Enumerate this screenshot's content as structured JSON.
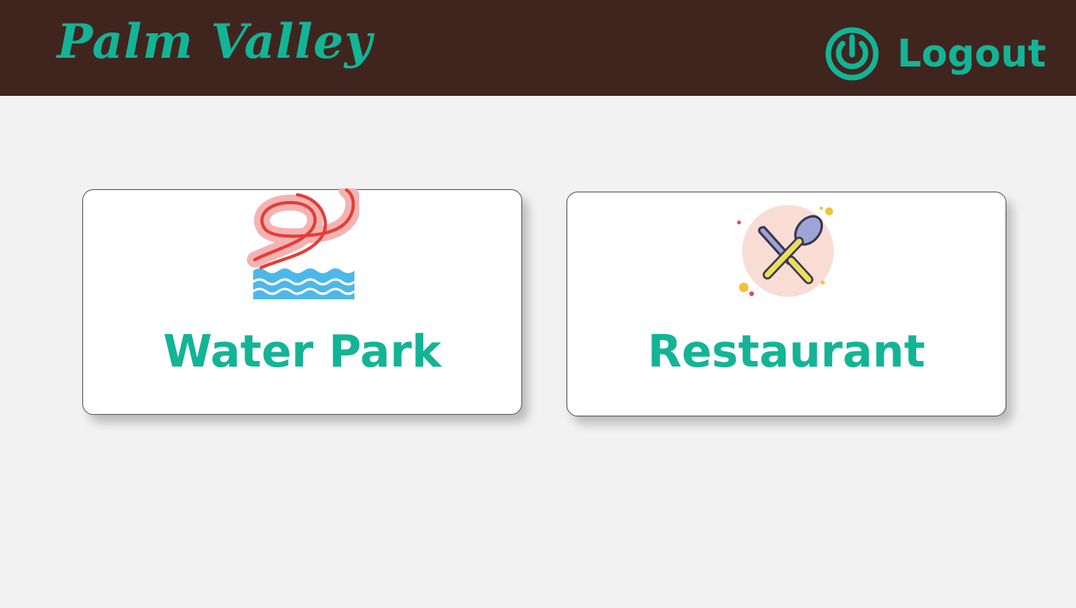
{
  "header": {
    "brand": "Palm Valley",
    "logout_label": "Logout",
    "logout_icon": "power-icon",
    "background_color": "#40251e",
    "accent_color": "#13b496"
  },
  "main": {
    "cards": [
      {
        "label": "Water Park",
        "icon": "water-slide-icon"
      },
      {
        "label": "Restaurant",
        "icon": "knife-spoon-icon"
      }
    ]
  }
}
